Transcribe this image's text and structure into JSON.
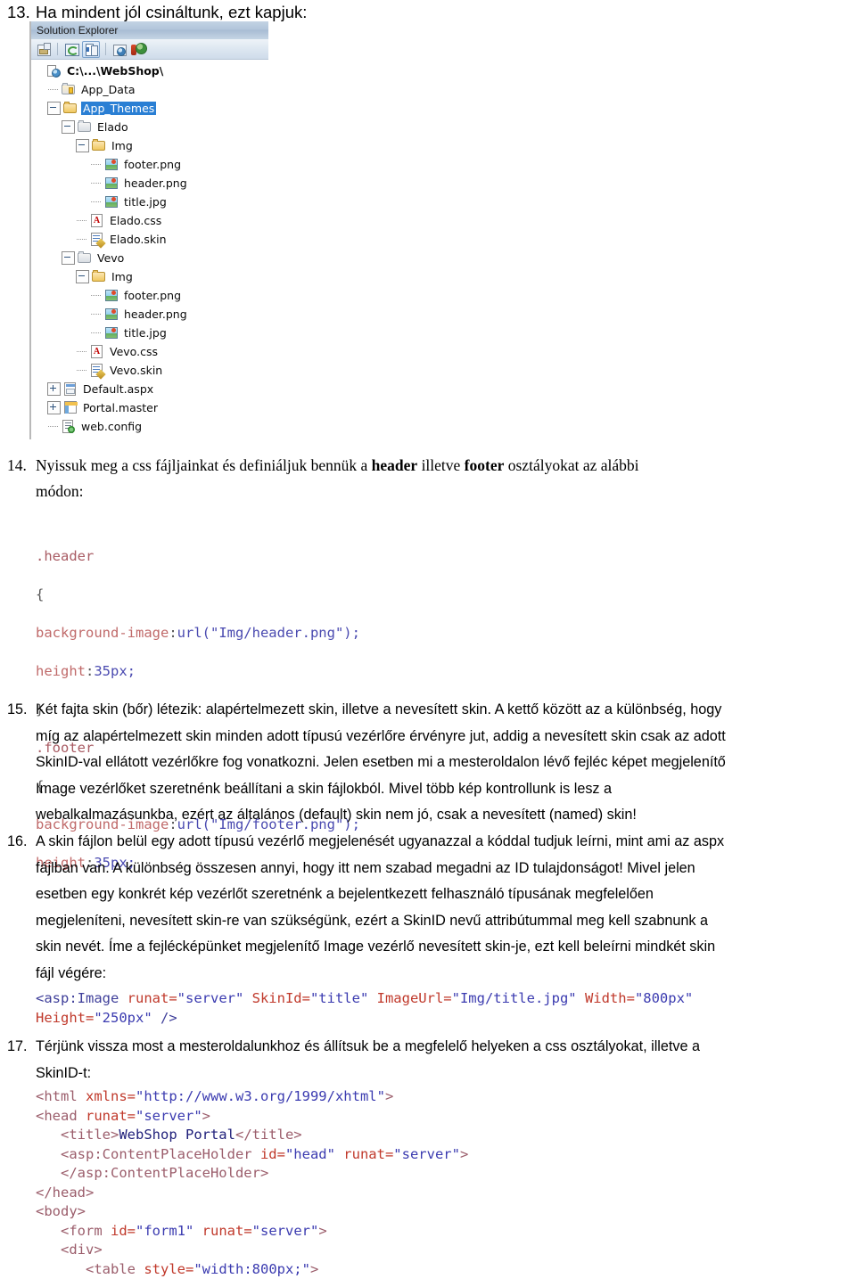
{
  "document": {
    "language": "hu",
    "type": "tutorial-worksheet"
  },
  "item13": {
    "number": "13.",
    "text": "Ha mindent jól csináltunk, ezt kapjuk:"
  },
  "solution_explorer": {
    "title": "Solution Explorer",
    "toolbar": [
      {
        "name": "properties-icon",
        "selected": false
      },
      {
        "name": "refresh-icon",
        "selected": false
      },
      {
        "name": "show-all-files-icon",
        "selected": true
      },
      {
        "name": "nest-related-files-icon",
        "selected": false
      },
      {
        "name": "asp-net-configuration-icon",
        "selected": false
      }
    ],
    "tree": [
      {
        "label": "C:\\...\\WebShop\\",
        "icon": "project-icon",
        "depth": 0,
        "twisty": "none",
        "selected": false
      },
      {
        "label": "App_Data",
        "icon": "folder-closed-icon",
        "depth": 1,
        "twisty": "leaf",
        "selected": false
      },
      {
        "label": "App_Themes",
        "icon": "folder-open-icon",
        "depth": 1,
        "twisty": "minus",
        "selected": true
      },
      {
        "label": "Elado",
        "icon": "folder-grey-icon",
        "depth": 2,
        "twisty": "minus",
        "selected": false
      },
      {
        "label": "Img",
        "icon": "folder-open-icon",
        "depth": 3,
        "twisty": "minus",
        "selected": false
      },
      {
        "label": "footer.png",
        "icon": "image-file-icon",
        "depth": 4,
        "twisty": "leaf",
        "selected": false
      },
      {
        "label": "header.png",
        "icon": "image-file-icon",
        "depth": 4,
        "twisty": "leaf",
        "selected": false
      },
      {
        "label": "title.jpg",
        "icon": "image-file-icon",
        "depth": 4,
        "twisty": "leaf",
        "selected": false
      },
      {
        "label": "Elado.css",
        "icon": "css-file-icon",
        "depth": 3,
        "twisty": "leaf",
        "selected": false
      },
      {
        "label": "Elado.skin",
        "icon": "skin-file-icon",
        "depth": 3,
        "twisty": "leaf",
        "selected": false
      },
      {
        "label": "Vevo",
        "icon": "folder-grey-icon",
        "depth": 2,
        "twisty": "minus",
        "selected": false
      },
      {
        "label": "Img",
        "icon": "folder-open-icon",
        "depth": 3,
        "twisty": "minus",
        "selected": false
      },
      {
        "label": "footer.png",
        "icon": "image-file-icon",
        "depth": 4,
        "twisty": "leaf",
        "selected": false
      },
      {
        "label": "header.png",
        "icon": "image-file-icon",
        "depth": 4,
        "twisty": "leaf",
        "selected": false
      },
      {
        "label": "title.jpg",
        "icon": "image-file-icon",
        "depth": 4,
        "twisty": "leaf",
        "selected": false
      },
      {
        "label": "Vevo.css",
        "icon": "css-file-icon",
        "depth": 3,
        "twisty": "leaf",
        "selected": false
      },
      {
        "label": "Vevo.skin",
        "icon": "skin-file-icon",
        "depth": 3,
        "twisty": "leaf",
        "selected": false
      },
      {
        "label": "Default.aspx",
        "icon": "aspx-file-icon",
        "depth": 1,
        "twisty": "plus",
        "selected": false
      },
      {
        "label": "Portal.master",
        "icon": "master-file-icon",
        "depth": 1,
        "twisty": "plus",
        "selected": false
      },
      {
        "label": "web.config",
        "icon": "config-file-icon",
        "depth": 1,
        "twisty": "leaf",
        "selected": false
      }
    ]
  },
  "item14": {
    "number": "14.",
    "line1_a": "Nyissuk meg a css fájljainkat és definiáljuk bennük a ",
    "bold1": "header",
    "line1_b": " illetve ",
    "bold2": "footer",
    "line1_c": " osztályokat az alábbi",
    "line2": "módon:"
  },
  "css_code": {
    "l1_sel": ".header",
    "l2_brace": "{",
    "l3_prop": "background-image",
    "l3_colon": ":",
    "l3_val": "url(\"Img/header.png\");",
    "l4_prop": "height",
    "l4_colon": ":",
    "l4_val": "35px;",
    "l5_brace": "}",
    "l6_sel": ".footer",
    "l7_brace": "{",
    "l8_prop": "background-image",
    "l8_colon": ":",
    "l8_val": "url(\"Img/footer.png\");",
    "l9_prop": "height",
    "l9_colon": ":",
    "l9_val": "35px;"
  },
  "item15": {
    "number": "15.",
    "line1": "Két fajta skin (bőr) létezik: alapértelmezett skin, illetve a nevesített skin. A kettő között az a különbség, hogy",
    "line2": "míg az alapértelmezett skin minden adott típusú vezérlőre érvényre jut, addig a nevesített skin csak az adott",
    "line3": "SkinID-val ellátott vezérlőkre fog vonatkozni. Jelen esetben mi a mesteroldalon lévő fejléc képet megjelenítő",
    "line4": "Image vezérlőket szeretnénk beállítani a skin fájlokból. Mivel több kép kontrollunk is lesz a",
    "line5": "webalkalmazásunkba, ezért az általános (default) skin nem jó, csak a nevesített (named) skin!"
  },
  "item16": {
    "number": "16.",
    "line1": "A skin fájlon belül egy adott típusú vezérlő megjelenését ugyanazzal a kóddal tudjuk leírni, mint ami az aspx",
    "line2": "fájlban van. A különbség összesen annyi, hogy itt nem szabad megadni az ID tulajdonságot! Mivel jelen",
    "line3": "esetben egy konkrét kép vezérlőt szeretnénk a bejelentkezett felhasználó típusának megfelelően",
    "line4": "megjeleníteni, nevesített skin-re van szükségünk, ezért a SkinID nevű  attribútummal meg kell szabnunk a",
    "line5": "skin nevét. Íme a fejlécképünket megjelenítő Image vezérlő nevesített skin-je, ezt kell beleírni mindkét skin",
    "line6": "fájl végére:"
  },
  "image_code": {
    "tag": "<asp:Image",
    "a1_name": " runat=",
    "a1_val": "\"server\"",
    "a2_name": " SkinId=",
    "a2_val": "\"title\"",
    "a3_name": " ImageUrl=",
    "a3_val": "\"Img/title.jpg\"",
    "a4_name": " Width=",
    "a4_val": "\"800px\"",
    "a5_name": "Height=",
    "a5_val": "\"250px\"",
    "close": " />"
  },
  "item17": {
    "number": "17.",
    "line1": "Térjünk vissza most a mesteroldalunkhoz és állítsuk be a megfelelő helyeken a css osztályokat, illetve a",
    "line2": "SkinID-t:"
  },
  "html_code": {
    "lines": [
      {
        "indent": 0,
        "parts": [
          {
            "t": "<html",
            "c": "tag"
          },
          {
            "t": " xmlns=",
            "c": "attr"
          },
          {
            "t": "\"http://www.w3.org/1999/xhtml\"",
            "c": "str"
          },
          {
            "t": ">",
            "c": "tag"
          }
        ]
      },
      {
        "indent": 0,
        "parts": [
          {
            "t": "<head",
            "c": "tag"
          },
          {
            "t": " runat=",
            "c": "attr"
          },
          {
            "t": "\"server\"",
            "c": "str"
          },
          {
            "t": ">",
            "c": "tag"
          }
        ]
      },
      {
        "indent": 1,
        "parts": [
          {
            "t": "<title>",
            "c": "tag"
          },
          {
            "t": "WebShop Portal",
            "c": "text"
          },
          {
            "t": "</title>",
            "c": "tag"
          }
        ]
      },
      {
        "indent": 1,
        "parts": [
          {
            "t": "<asp:ContentPlaceHolder",
            "c": "tag"
          },
          {
            "t": " id=",
            "c": "attr"
          },
          {
            "t": "\"head\"",
            "c": "str"
          },
          {
            "t": " runat=",
            "c": "attr"
          },
          {
            "t": "\"server\"",
            "c": "str"
          },
          {
            "t": ">",
            "c": "tag"
          }
        ]
      },
      {
        "indent": 1,
        "parts": [
          {
            "t": "</asp:ContentPlaceHolder>",
            "c": "tag"
          }
        ]
      },
      {
        "indent": 0,
        "parts": [
          {
            "t": "</head>",
            "c": "tag"
          }
        ]
      },
      {
        "indent": 0,
        "parts": [
          {
            "t": "<body>",
            "c": "tag"
          }
        ]
      },
      {
        "indent": 1,
        "parts": [
          {
            "t": "<form",
            "c": "tag"
          },
          {
            "t": " id=",
            "c": "attr"
          },
          {
            "t": "\"form1\"",
            "c": "str"
          },
          {
            "t": " runat=",
            "c": "attr"
          },
          {
            "t": "\"server\"",
            "c": "str"
          },
          {
            "t": ">",
            "c": "tag"
          }
        ]
      },
      {
        "indent": 1,
        "parts": [
          {
            "t": "<div>",
            "c": "tag"
          }
        ]
      },
      {
        "indent": 2,
        "parts": [
          {
            "t": "<table",
            "c": "tag"
          },
          {
            "t": " style=",
            "c": "attr"
          },
          {
            "t": "\"width:800px;\"",
            "c": "str"
          },
          {
            "t": ">",
            "c": "tag"
          }
        ]
      }
    ]
  },
  "colors": {
    "selection_blue": "#2a7fd4",
    "attr_red": "#c0392b",
    "value_blue": "#3b3bb0",
    "tag_mauve": "#9b5d6b",
    "css_prop": "#c06a6a",
    "css_value": "#4a4ab0"
  }
}
